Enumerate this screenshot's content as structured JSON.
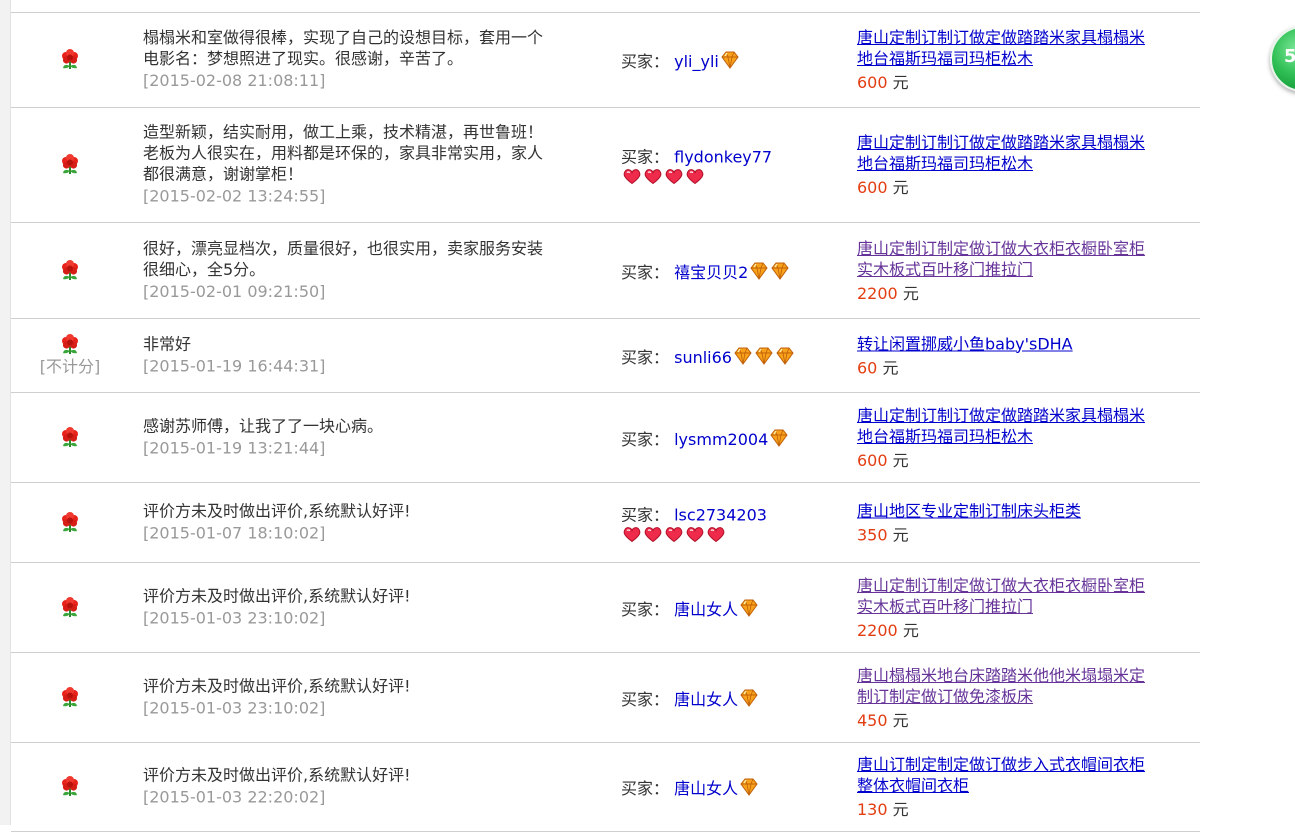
{
  "float_button": {
    "label": "5"
  },
  "colors": {
    "buyer_link": "#0000cc",
    "visited_link": "#663399",
    "price": "#e33d12",
    "time": "#999999"
  },
  "reviews": [
    {
      "comment_lines": [
        "榻榻米和室做得很棒，实现了自己的设想目标，套用一个",
        "电影名：梦想照进了现实。很感谢，辛苦了。"
      ],
      "time": "[2015-02-08 21:08:11]",
      "buyer_label": "买家：",
      "buyer": "yli_yli",
      "badge": "diamond-1",
      "item_lines": [
        "唐山定制订制订做定做踏踏米家具榻榻米",
        "地台福斯玛福司玛柜松木"
      ],
      "price": "600",
      "currency": "元"
    },
    {
      "comment_lines": [
        "造型新颖，结实耐用，做工上乘，技术精湛，再世鲁班！",
        "老板为人很实在，用料都是环保的，家具非常实用，家人",
        "都很满意，谢谢掌柜！"
      ],
      "time": "[2015-02-02 13:24:55]",
      "buyer_label": "买家：",
      "buyer": "flydonkey77",
      "badge": "heart-4",
      "item_lines": [
        "唐山定制订制订做定做踏踏米家具榻榻米",
        "地台福斯玛福司玛柜松木"
      ],
      "price": "600",
      "currency": "元"
    },
    {
      "comment_lines": [
        "很好，漂亮显档次，质量很好，也很实用，卖家服务安装",
        "很细心，全5分。"
      ],
      "time": "[2015-02-01 09:21:50]",
      "buyer_label": "买家：",
      "buyer": "禧宝贝贝2",
      "badge": "diamond-2",
      "item_lines": [
        "唐山定制订制定做订做大衣柜衣橱卧室柜",
        "实木板式百叶移门推拉门"
      ],
      "price": "2200",
      "currency": "元"
    },
    {
      "comment_lines": [
        "非常好"
      ],
      "time": "[2015-01-19 16:44:31]",
      "no_count": "[不计分]",
      "buyer_label": "买家：",
      "buyer": "sunli66",
      "badge": "diamond-3",
      "item_lines": [
        "转让闲置挪威小鱼baby'sDHA"
      ],
      "price": "60",
      "currency": "元"
    },
    {
      "comment_lines": [
        "感谢苏师傅，让我了了一块心病。"
      ],
      "time": "[2015-01-19 13:21:44]",
      "buyer_label": "买家：",
      "buyer": "lysmm2004",
      "badge": "diamond-1",
      "item_lines": [
        "唐山定制订制订做定做踏踏米家具榻榻米",
        "地台福斯玛福司玛柜松木"
      ],
      "price": "600",
      "currency": "元"
    },
    {
      "comment_lines": [
        "评价方未及时做出评价,系统默认好评!"
      ],
      "time": "[2015-01-07 18:10:02]",
      "buyer_label": "买家：",
      "buyer": "lsc2734203",
      "badge": "heart-5",
      "item_lines": [
        "唐山地区专业定制订制床头柜类"
      ],
      "price": "350",
      "currency": "元"
    },
    {
      "comment_lines": [
        "评价方未及时做出评价,系统默认好评!"
      ],
      "time": "[2015-01-03 23:10:02]",
      "buyer_label": "买家：",
      "buyer": "唐山女人",
      "badge": "diamond-1",
      "item_lines": [
        "唐山定制订制定做订做大衣柜衣橱卧室柜",
        "实木板式百叶移门推拉门"
      ],
      "price": "2200",
      "currency": "元"
    },
    {
      "comment_lines": [
        "评价方未及时做出评价,系统默认好评!"
      ],
      "time": "[2015-01-03 23:10:02]",
      "buyer_label": "买家：",
      "buyer": "唐山女人",
      "badge": "diamond-1",
      "item_lines": [
        "唐山榻榻米地台床踏踏米他他米塌塌米定",
        "制订制定做订做免漆板床"
      ],
      "price": "450",
      "currency": "元"
    },
    {
      "comment_lines": [
        "评价方未及时做出评价,系统默认好评!"
      ],
      "time": "[2015-01-03 22:20:02]",
      "buyer_label": "买家：",
      "buyer": "唐山女人",
      "badge": "diamond-1",
      "item_lines": [
        "唐山订制定制定做订做步入式衣帽间衣柜",
        "整体衣帽间衣柜"
      ],
      "price": "130",
      "currency": "元"
    }
  ]
}
